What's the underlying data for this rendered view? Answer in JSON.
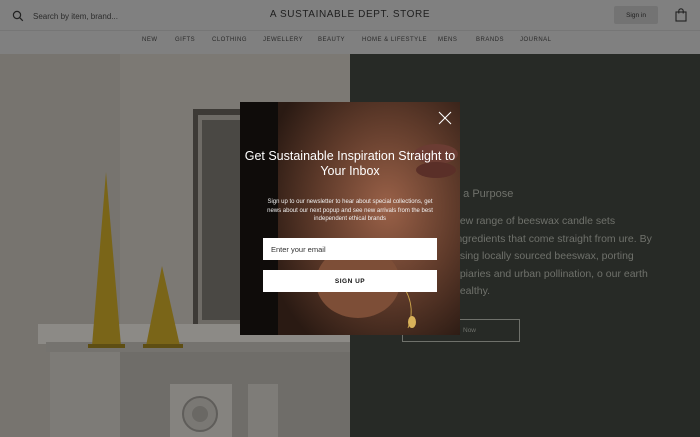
{
  "header": {
    "search_placeholder": "Search by item, brand...",
    "brand_title": "A SUSTAINABLE DEPT. STORE",
    "signin_label": "Sign in",
    "icons": {
      "search": "search-icon",
      "bag": "shopping-bag-icon"
    }
  },
  "nav": {
    "items": [
      "NEW",
      "GIFTS",
      "CLOTHING",
      "JEWELLERY",
      "BEAUTY",
      "HOME & LIFESTYLE",
      "MENS",
      "BRANDS",
      "JOURNAL"
    ]
  },
  "hero": {
    "kicker": "h a Purpose",
    "body": "new range of beeswax candle sets ingredients that come straight from ure. By using locally sourced beeswax, porting apiaries and urban pollination, o our earth healthy.",
    "cta_label": "Now"
  },
  "modal": {
    "title": "Get Sustainable Inspiration Straight to Your Inbox",
    "description": "Sign up to our newsletter to hear about special collections, get news about our next popup and see new arrivals from the best independent ethical brands",
    "email_placeholder": "Enter your email",
    "submit_label": "SIGN UP",
    "close_icon": "close-icon"
  },
  "colors": {
    "overlay_header": "#808080",
    "hero_right_bg": "#272a26",
    "candle": "#7a6518",
    "modal_text": "#ffffff"
  }
}
